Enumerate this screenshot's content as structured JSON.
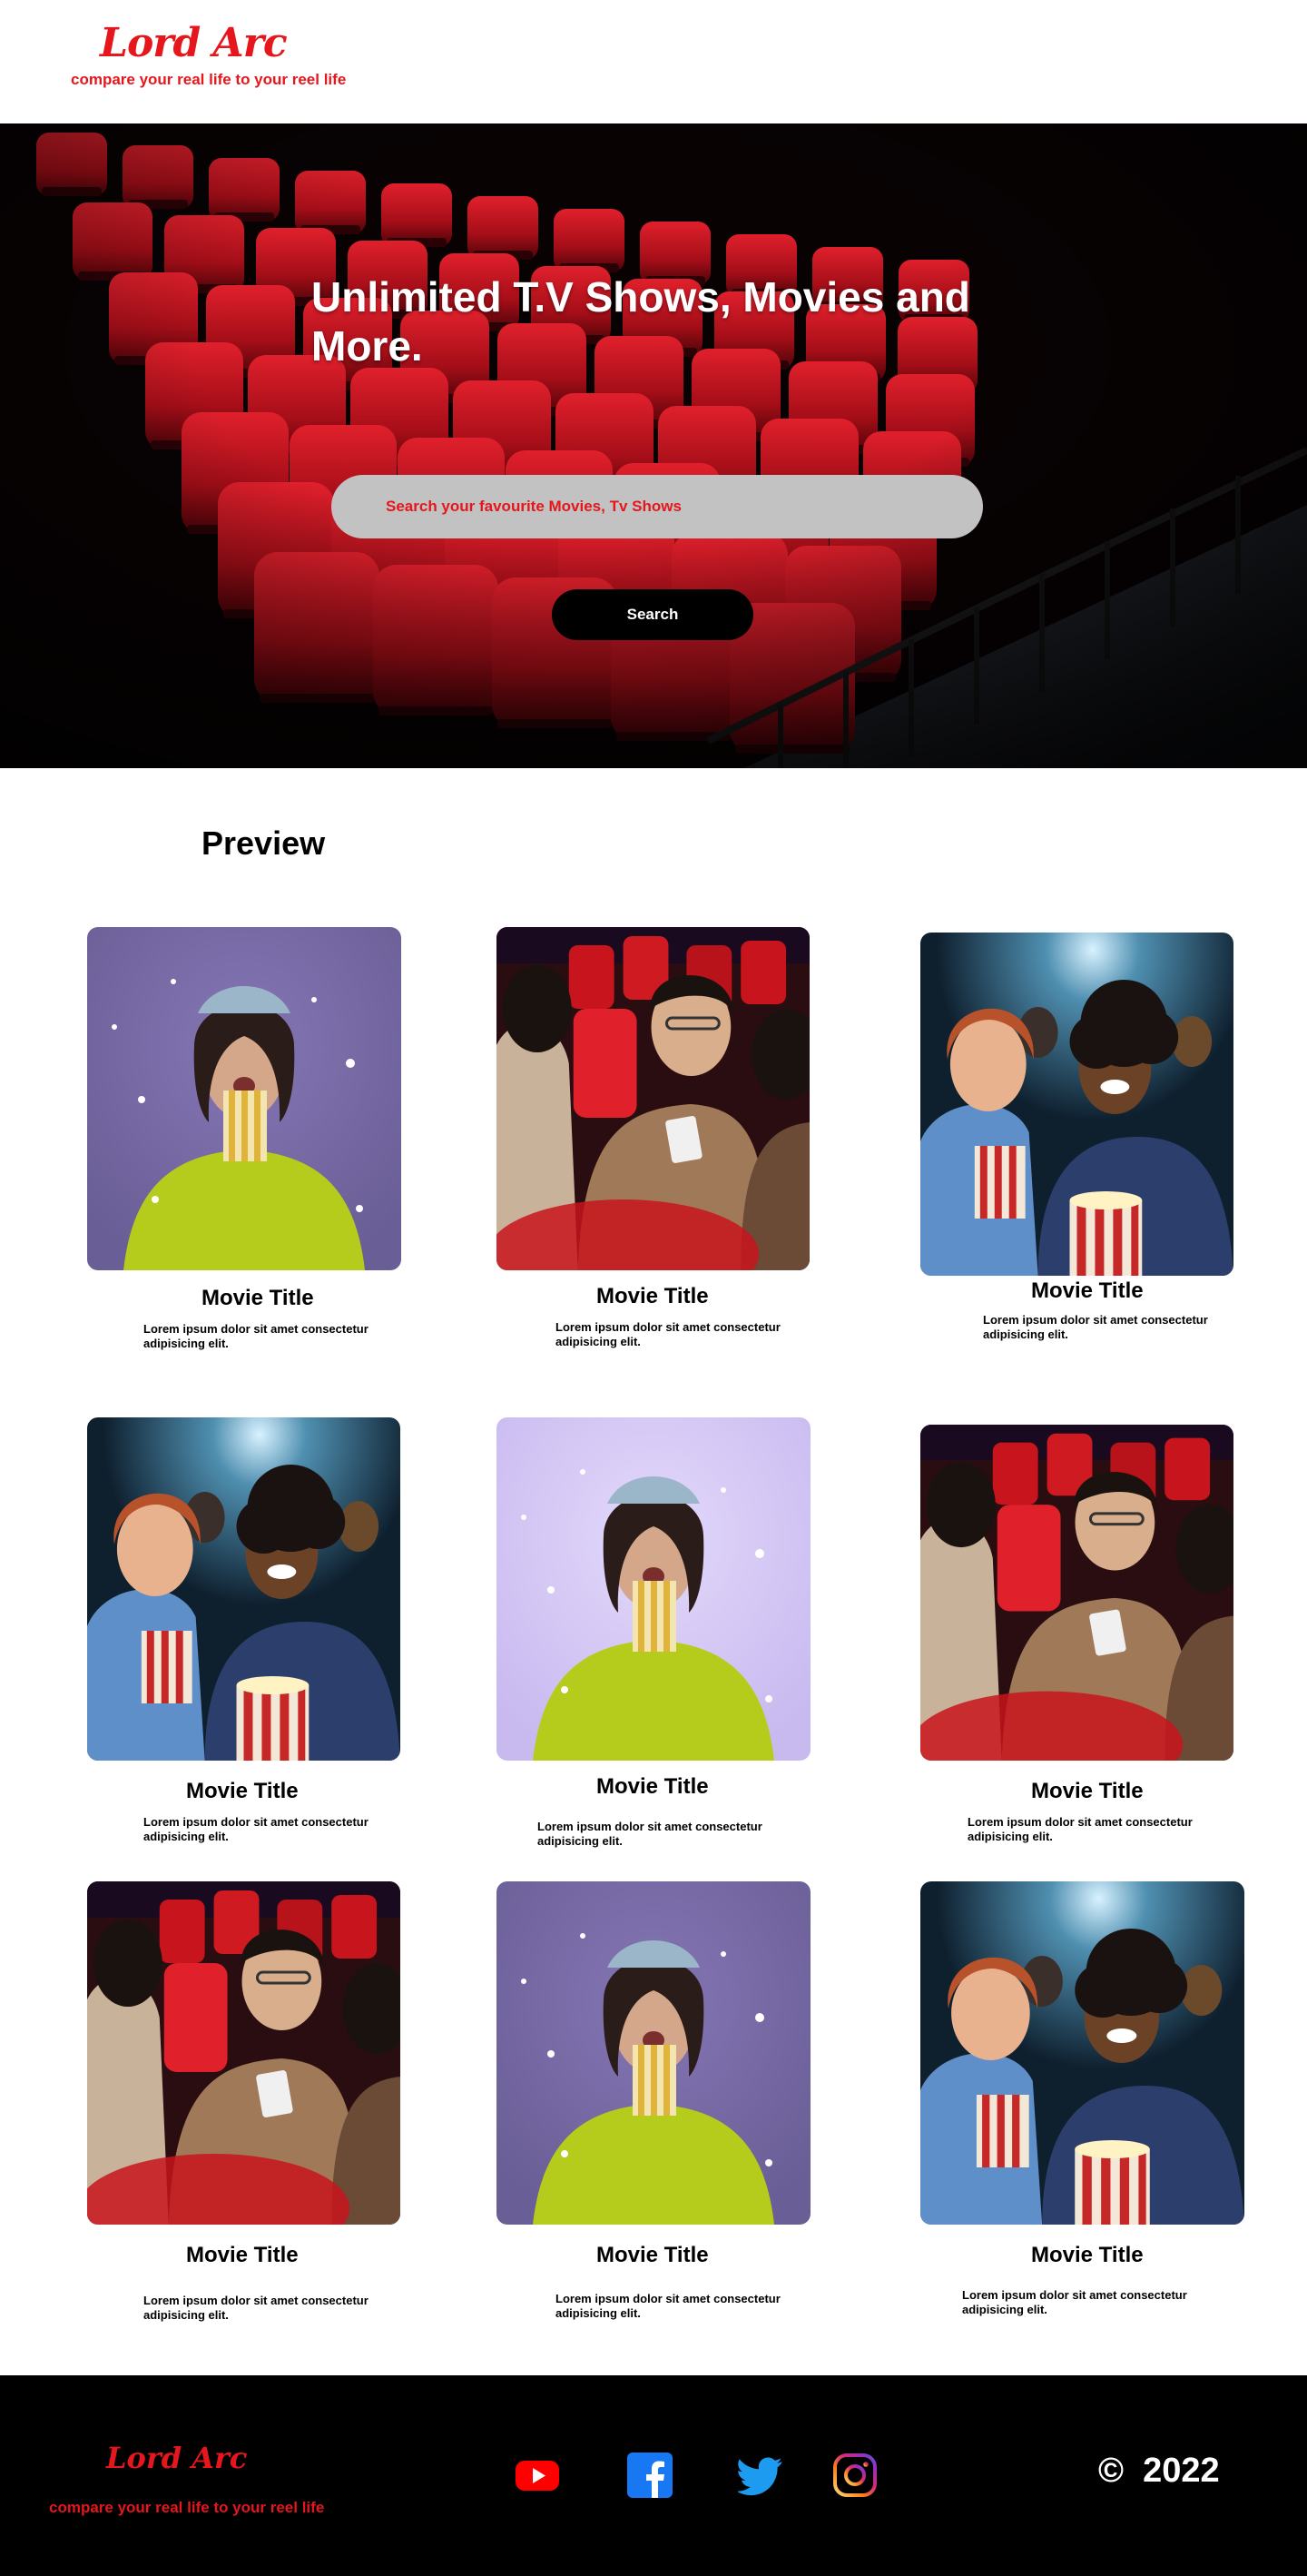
{
  "brand": {
    "name": "Lord Arc",
    "tagline": "compare your real life to your reel life",
    "color": "#e5161c"
  },
  "hero": {
    "title": "Unlimited  T.V Shows, Movies and More.",
    "search_placeholder": "Search your favourite Movies, Tv Shows",
    "search_button": "Search"
  },
  "preview": {
    "heading": "Preview",
    "cards": [
      {
        "title": "Movie  Title",
        "desc": "Lorem ipsum dolor sit amet consectetur adipisicing elit.",
        "image": "woman-popcorn"
      },
      {
        "title": "Movie  Title",
        "desc": "Lorem ipsum dolor sit amet consectetur adipisicing elit.",
        "image": "audience-red-seats"
      },
      {
        "title": "Movie  Title",
        "desc": "Lorem ipsum dolor sit amet consectetur adipisicing elit.",
        "image": "laughing-audience"
      },
      {
        "title": "Movie  Title",
        "desc": "Lorem ipsum dolor sit amet consectetur adipisicing elit.",
        "image": "laughing-audience"
      },
      {
        "title": "Movie  Title",
        "desc": "Lorem ipsum dolor sit amet consectetur adipisicing elit.",
        "image": "woman-popcorn-light"
      },
      {
        "title": "Movie  Title",
        "desc": "Lorem ipsum dolor sit amet consectetur adipisicing elit.",
        "image": "audience-red-seats"
      },
      {
        "title": "Movie  Title",
        "desc": "Lorem ipsum dolor sit amet consectetur adipisicing elit.",
        "image": "audience-red-seats"
      },
      {
        "title": "Movie  Title",
        "desc": "Lorem ipsum dolor sit amet consectetur adipisicing elit.",
        "image": "woman-popcorn"
      },
      {
        "title": "Movie  Title",
        "desc": "Lorem ipsum dolor sit amet consectetur adipisicing elit.",
        "image": "laughing-audience"
      }
    ]
  },
  "footer": {
    "brand": "Lord Arc",
    "tagline": "compare your real life to your reel life",
    "social": [
      "youtube-icon",
      "facebook-icon",
      "twitter-icon",
      "instagram-icon"
    ],
    "copyright_symbol": "©",
    "copyright_year": "2022"
  }
}
